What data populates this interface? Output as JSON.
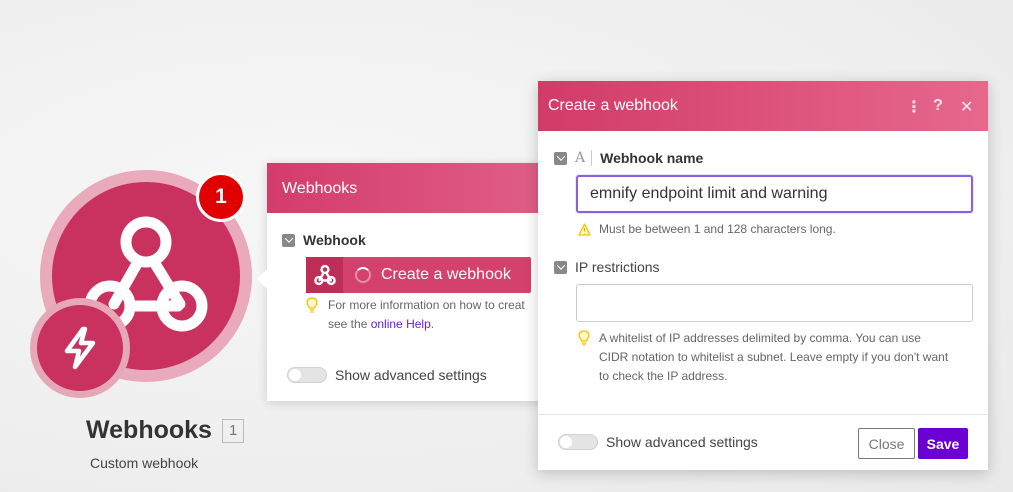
{
  "module": {
    "badge_count": "1",
    "title": "Webhooks",
    "count": "1",
    "subtitle": "Custom webhook",
    "icon": "webhook-icon",
    "trigger_icon": "instant-trigger-icon",
    "colors": {
      "primary": "#c9325f",
      "halo": "#e9aabb",
      "badge": "#e00000"
    }
  },
  "webhooks_panel": {
    "title": "Webhooks",
    "field_label": "Webhook",
    "create_button_label": "Create a webhook",
    "hint_line1": "For more information on how to creat",
    "hint_line2_prefix": "see the ",
    "hint_link": "online Help",
    "hint_line2_suffix": ".",
    "advanced_label": "Show advanced settings"
  },
  "dialog": {
    "title": "Create a webhook",
    "tools": {
      "more": "⋮",
      "help": "?",
      "close": "✕"
    },
    "name_field": {
      "label": "Webhook name",
      "value": "emnify endpoint limit and warning",
      "warning": "Must be between 1 and 128 characters long."
    },
    "ip_field": {
      "label": "IP restrictions",
      "value": "",
      "hint_line1": "A whitelist of IP addresses delimited by comma. You can use",
      "hint_line2": "CIDR notation to whitelist a subnet. Leave empty if you don't want",
      "hint_line3": "to check the IP address."
    },
    "advanced_label": "Show advanced settings",
    "close_label": "Close",
    "save_label": "Save",
    "colors": {
      "header": "#d23b68",
      "save": "#6b00d3",
      "focus": "#8b60e0",
      "warning": "#f2c200"
    }
  }
}
